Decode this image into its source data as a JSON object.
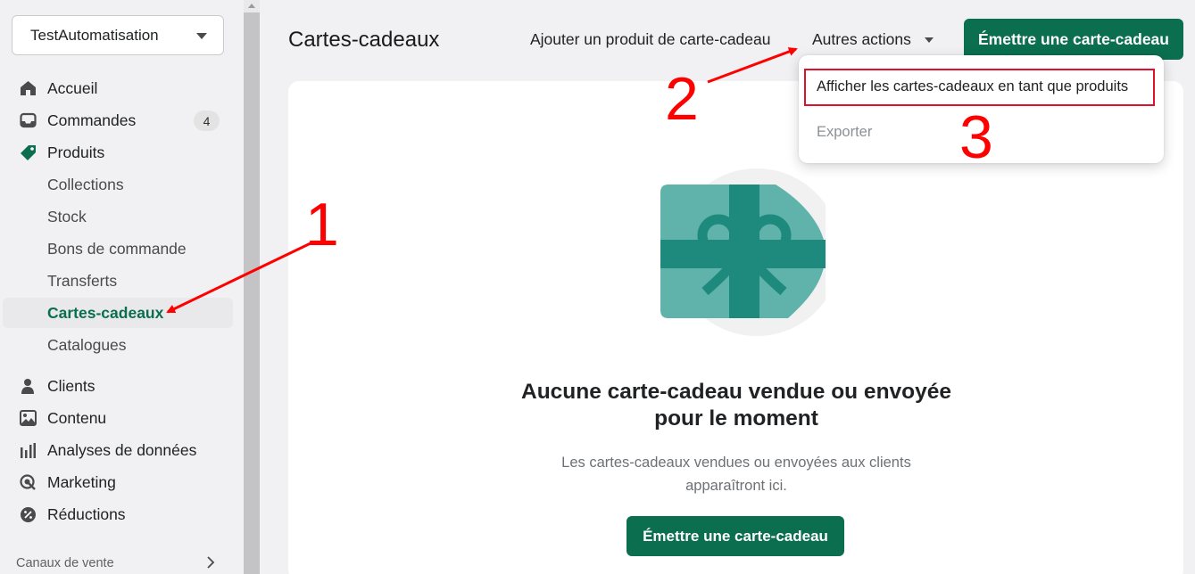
{
  "store": {
    "name": "TestAutomatisation"
  },
  "nav": {
    "home": "Accueil",
    "orders": "Commandes",
    "orders_count": "4",
    "products": "Produits",
    "collections": "Collections",
    "inventory": "Stock",
    "purchase_orders": "Bons de commande",
    "transfers": "Transferts",
    "gift_cards": "Cartes-cadeaux",
    "catalogs": "Catalogues",
    "customers": "Clients",
    "content": "Contenu",
    "analytics": "Analyses de données",
    "marketing": "Marketing",
    "discounts": "Réductions",
    "sales_channels": "Canaux de vente"
  },
  "header": {
    "title": "Cartes-cadeaux",
    "add_product": "Ajouter un produit de carte-cadeau",
    "other_actions": "Autres actions",
    "issue_button": "Émettre une carte-cadeau"
  },
  "dropdown": {
    "view_as_products": "Afficher les cartes-cadeaux en tant que produits",
    "export": "Exporter"
  },
  "empty_state": {
    "title_line1": "Aucune carte-cadeau vendue ou envoyée",
    "title_line2": "pour le moment",
    "subtitle_line1": "Les cartes-cadeaux vendues ou envoyées aux clients",
    "subtitle_line2": "apparaîtront ici.",
    "button": "Émettre une carte-cadeau"
  },
  "annotations": {
    "step1": "1",
    "step2": "2",
    "step3": "3"
  },
  "colors": {
    "primary_green": "#0b6e4f",
    "annotation_red": "#ff0000",
    "illustration_light": "#5fb3aa",
    "illustration_dark": "#1e8a7d"
  },
  "icons": {
    "home": "home-icon",
    "orders": "inbox-icon",
    "products": "tag-icon",
    "customers": "person-icon",
    "content": "image-icon",
    "analytics": "bar-chart-icon",
    "marketing": "target-icon",
    "discounts": "discount-icon"
  }
}
